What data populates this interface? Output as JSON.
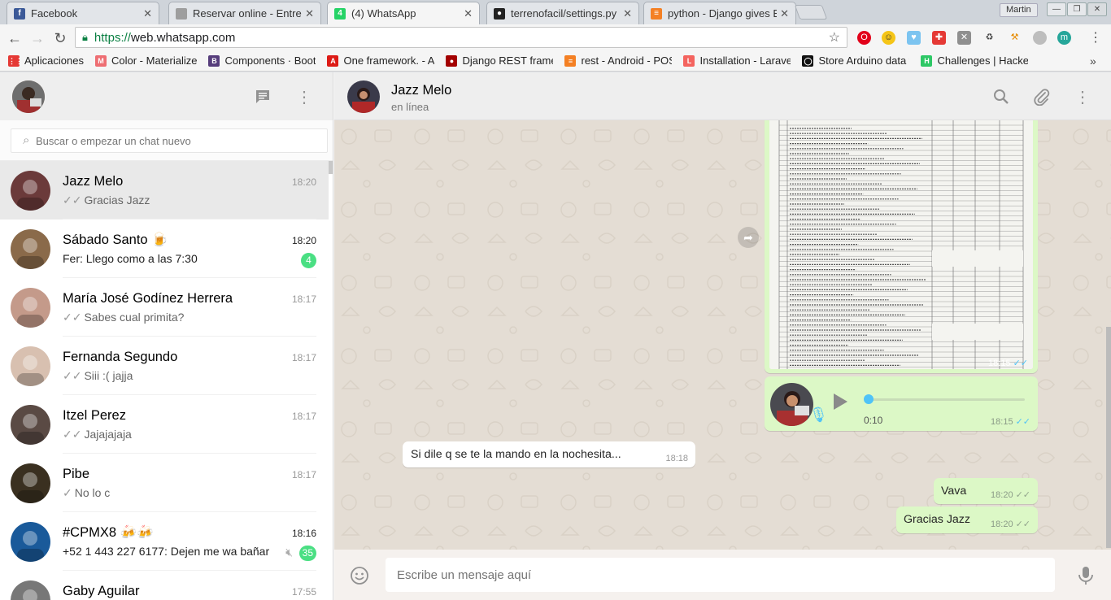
{
  "browser": {
    "tabs": [
      {
        "title": "Facebook",
        "icon": "facebook-icon",
        "color": "#3b5998",
        "glyph": "f"
      },
      {
        "title": "Reservar online - Entreg",
        "icon": "document-icon",
        "color": "#9e9e9e",
        "glyph": ""
      },
      {
        "title": "(4) WhatsApp",
        "icon": "whatsapp-icon",
        "color": "#25d366",
        "glyph": "4"
      },
      {
        "title": "terrenofacil/settings.py",
        "icon": "github-icon",
        "color": "#222222",
        "glyph": "●"
      },
      {
        "title": "python - Django gives B",
        "icon": "stackoverflow-icon",
        "color": "#f48024",
        "glyph": "≡"
      }
    ],
    "active_tab_index": 2,
    "user_name": "Martin",
    "url_scheme": "https://",
    "url_host": "web.whatsapp.com",
    "bookmarks": [
      {
        "label": "Aplicaciones",
        "color": "#e53935",
        "glyph": "⋮⋮"
      },
      {
        "label": "Color - Materialize",
        "color": "#ee6e73",
        "glyph": "M"
      },
      {
        "label": "Components · Bootst",
        "color": "#563d7c",
        "glyph": "B"
      },
      {
        "label": "One framework. - An",
        "color": "#dd1b16",
        "glyph": "A"
      },
      {
        "label": "Django REST framew",
        "color": "#a30000",
        "glyph": "●"
      },
      {
        "label": "rest - Android - POST",
        "color": "#f48024",
        "glyph": "≡"
      },
      {
        "label": "Installation - Laravel",
        "color": "#f4645f",
        "glyph": "L"
      },
      {
        "label": "Store Arduino data to",
        "color": "#111111",
        "glyph": "◯"
      },
      {
        "label": "Challenges | Hacker",
        "color": "#2ec866",
        "glyph": "H"
      }
    ],
    "bookmarks_more": "»"
  },
  "sidebar": {
    "search_placeholder": "Buscar o empezar un chat nuevo",
    "chats": [
      {
        "name": "Jazz Melo",
        "time": "18:20",
        "last": "Gracias Jazz",
        "tick": "✓✓",
        "selected": true,
        "avatar_color": "#6b3a3a"
      },
      {
        "name": "Sábado Santo 🍺",
        "time": "18:20",
        "last": "Fer: Llego como a las 7:30",
        "tick": "",
        "unread": "4",
        "avatar_color": "#8a6a4a"
      },
      {
        "name": "María José Godínez Herrera",
        "time": "18:17",
        "last": "Sabes cual primita?",
        "tick": "✓✓",
        "avatar_color": "#c49a8a"
      },
      {
        "name": "Fernanda Segundo",
        "time": "18:17",
        "last": "Siii :( jajja",
        "tick": "✓✓",
        "avatar_color": "#d8c0b0"
      },
      {
        "name": "Itzel Perez",
        "time": "18:17",
        "last": "Jajajajaja",
        "tick": "✓✓",
        "avatar_color": "#5a4a44"
      },
      {
        "name": "Pibe",
        "time": "18:17",
        "last": "No lo c",
        "tick": "✓",
        "avatar_color": "#3a3020"
      },
      {
        "name": "#CPMX8 🍻🍻",
        "time": "18:16",
        "last": "+52 1 443 227 6177: Dejen me wa bañar",
        "tick": "",
        "unread": "35",
        "muted": true,
        "avatar_color": "#1a5a9a"
      },
      {
        "name": "Gaby Aguilar",
        "time": "17:55",
        "last": "",
        "tick": "",
        "avatar_color": "#777777"
      }
    ]
  },
  "conversation": {
    "contact_name": "Jazz Melo",
    "status": "en línea",
    "messages": [
      {
        "type": "image",
        "direction": "out",
        "time": "18:15"
      },
      {
        "type": "audio",
        "direction": "out",
        "duration": "0:10",
        "time": "18:15"
      },
      {
        "type": "text",
        "direction": "in",
        "text": "Si dile q se te la mando en la nochesita...",
        "time": "18:18"
      },
      {
        "type": "text",
        "direction": "out",
        "text": "Vava",
        "time": "18:20"
      },
      {
        "type": "text",
        "direction": "out",
        "text": "Gracias Jazz",
        "time": "18:20"
      }
    ],
    "input_placeholder": "Escribe un mensaje aquí"
  },
  "colors": {
    "outgoing_bubble": "#dcf8c6",
    "incoming_bubble": "#ffffff",
    "unread_badge": "#4adf83",
    "read_tick": "#4fc3f7",
    "chat_background": "#e4ddd4"
  }
}
